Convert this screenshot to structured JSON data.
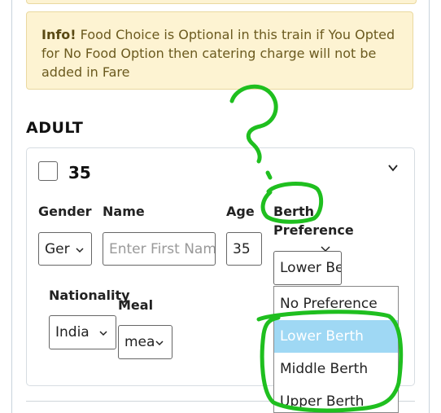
{
  "info": {
    "strong": "Info!",
    "text": " Food Choice is Optional in this train if You Opted for No Food Option then catering charge will not be added in Fare"
  },
  "section": {
    "heading": "ADULT"
  },
  "passenger": {
    "number": "35",
    "labels": {
      "gender": "Gender",
      "name": "Name",
      "age": "Age",
      "berth_line1": "Berth",
      "berth_line2": "Preference",
      "nationality": "Nationality",
      "meal": "Meal"
    },
    "gender_value": "Ger",
    "name_placeholder": "Enter First Name",
    "age_value": "35",
    "berth_value": "Lower Be",
    "nationality_value": "India",
    "meal_value": "mea"
  },
  "berth_options": [
    "No Preference",
    "Lower Berth",
    "Middle Berth",
    "Upper Berth"
  ],
  "berth_selected": "Lower Berth",
  "colors": {
    "annotation": "#1fbf1f",
    "selected_option": "#9fd8f4",
    "info_bg": "#fdf3d2"
  }
}
